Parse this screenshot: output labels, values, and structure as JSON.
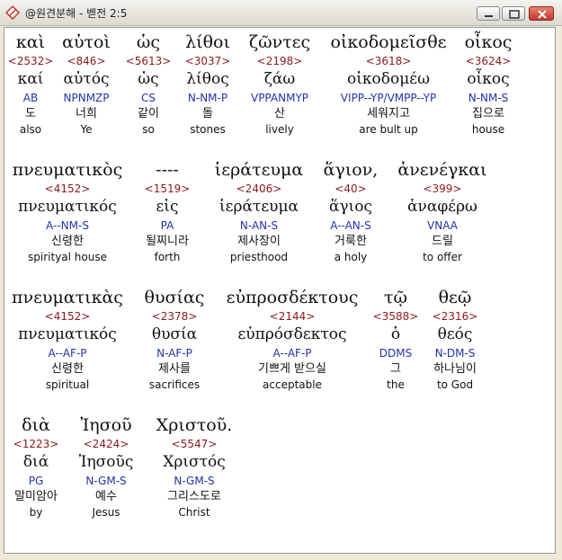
{
  "window": {
    "title": "@원견분해 - 벧전 2:5",
    "icon": "bible-app-icon"
  },
  "verse": {
    "lines": [
      [
        {
          "greek": "καὶ",
          "strong": "<2532>",
          "lemma": "καί",
          "morph": "AB",
          "korean": "도",
          "english": "also"
        },
        {
          "greek": "αὐτοὶ",
          "strong": "<846>",
          "lemma": "αὐτός",
          "morph": "NPNMZP",
          "korean": "너희",
          "english": "Ye"
        },
        {
          "greek": "ὡς",
          "strong": "<5613>",
          "lemma": "ὡς",
          "morph": "CS",
          "korean": "같이",
          "english": "so"
        },
        {
          "greek": "λίθοι",
          "strong": "<3037>",
          "lemma": "λίθος",
          "morph": "N-NM-P",
          "korean": "돌",
          "english": "stones"
        },
        {
          "greek": "ζῶντες",
          "strong": "<2198>",
          "lemma": "ζάω",
          "morph": "VPPANMYP",
          "korean": "산",
          "english": "lively"
        },
        {
          "greek": "οἰκοδομεῖσθε",
          "strong": "<3618>",
          "lemma": "οἰκοδομέω",
          "morph": "VIPP--YP/VMPP--YP",
          "korean": "세워지고",
          "english": "are bult up"
        },
        {
          "greek": "οἶκος",
          "strong": "<3624>",
          "lemma": "οἶκος",
          "morph": "N-NM-S",
          "korean": "집으로",
          "english": "house"
        }
      ],
      [
        {
          "greek": "πνευματικὸς",
          "strong": "<4152>",
          "lemma": "πνευματικός",
          "morph": "A--NM-S",
          "korean": "신령한",
          "english": "spirityal house"
        },
        {
          "greek": "----",
          "strong": "<1519>",
          "lemma": "εἰς",
          "morph": "PA",
          "korean": "될찌니라",
          "english": "forth"
        },
        {
          "greek": "ἱεράτευμα",
          "strong": "<2406>",
          "lemma": "ἱεράτευμα",
          "morph": "N-AN-S",
          "korean": "제사장이",
          "english": "priesthood"
        },
        {
          "greek": "ἅγιον,",
          "strong": "<40>",
          "lemma": "ἅγιος",
          "morph": "A--AN-S",
          "korean": "거룩한",
          "english": "a holy"
        },
        {
          "greek": "ἀνενέγκαι",
          "strong": "<399>",
          "lemma": "ἀναφέρω",
          "morph": "VNAA",
          "korean": "드릴",
          "english": "to offer"
        }
      ],
      [
        {
          "greek": "πνευματικὰς",
          "strong": "<4152>",
          "lemma": "πνευματικός",
          "morph": "A--AF-P",
          "korean": "신령한",
          "english": "spiritual"
        },
        {
          "greek": "θυσίας",
          "strong": "<2378>",
          "lemma": "θυσία",
          "morph": "N-AF-P",
          "korean": "제사를",
          "english": "sacrifices"
        },
        {
          "greek": "εὐπροσδέκτους",
          "strong": "<2144>",
          "lemma": "εὐπρόσδεκτος",
          "morph": "A--AF-P",
          "korean": "기쁘게 받으실",
          "english": "acceptable"
        },
        {
          "greek": "τῷ",
          "strong": "<3588>",
          "lemma": "ὁ",
          "morph": "DDMS",
          "korean": "그",
          "english": "the"
        },
        {
          "greek": "θεῷ",
          "strong": "<2316>",
          "lemma": "θεός",
          "morph": "N-DM-S",
          "korean": "하나님이",
          "english": "to God"
        }
      ],
      [
        {
          "greek": "διὰ",
          "strong": "<1223>",
          "lemma": "διά",
          "morph": "PG",
          "korean": "말미암아",
          "english": "by"
        },
        {
          "greek": "Ἰησοῦ",
          "strong": "<2424>",
          "lemma": "Ἰησοῦς",
          "morph": "N-GM-S",
          "korean": "예수",
          "english": "Jesus"
        },
        {
          "greek": "Χριστοῦ.",
          "strong": "<5547>",
          "lemma": "Χριστός",
          "morph": "N-GM-S",
          "korean": "그리스도로",
          "english": "Christ"
        }
      ]
    ]
  },
  "colors": {
    "strong": "#8b1a1a",
    "morph": "#2233aa",
    "text": "#111111"
  }
}
